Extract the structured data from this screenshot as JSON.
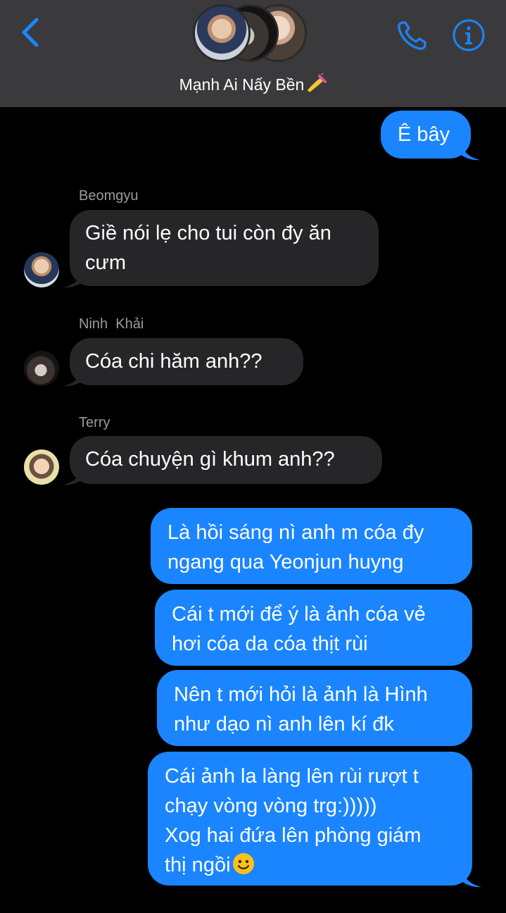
{
  "header": {
    "group_name": "Mạnh Ai Nấy Bền",
    "group_emoji": "nail-polish",
    "accent_color": "#1a85ff",
    "header_bg": "#3a3a3c",
    "icons": {
      "back": "chevron-left-icon",
      "call": "phone-icon",
      "info": "info-icon"
    }
  },
  "messages": {
    "m1": {
      "lines": [
        "Ê bây"
      ]
    },
    "m2": {
      "sender": "Beomgyu",
      "lines": [
        "Giề nói lẹ cho tui còn đy ăn",
        "cưm"
      ]
    },
    "m3": {
      "sender": "Ninh  Khải",
      "lines": [
        "Cóa chi hăm anh??"
      ]
    },
    "m4": {
      "sender": "Terry",
      "lines": [
        "Cóa chuyện gì khum anh??"
      ]
    },
    "m5": {
      "lines": [
        "Là hồi sáng nì anh m cóa đy",
        "ngang qua Yeonjun huyng"
      ]
    },
    "m6": {
      "lines": [
        "Cái t mới để ý là ảnh cóa vẻ",
        "hơi cóa da cóa thịt rùi"
      ]
    },
    "m7": {
      "lines": [
        "Nên t mới hỏi là ảnh là Hình",
        "như dạo nì anh lên kí đk"
      ]
    },
    "m8": {
      "lines": [
        "Cái ảnh la làng lên rùi rượt t",
        "chạy vòng vòng trg:)))))",
        "Xog hai đứa lên phòng giám",
        "thị ngồi"
      ],
      "trailing_emoji": "slightly-smiling-face"
    }
  },
  "colors": {
    "incoming_bubble": "#262629",
    "outgoing_bubble": "#1a85ff",
    "sender_label": "#9b9ba0"
  }
}
